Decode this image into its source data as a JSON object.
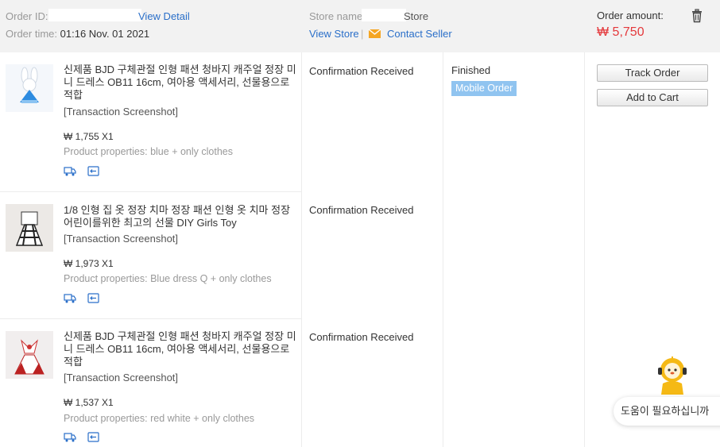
{
  "header": {
    "order_id_label": "Order ID:",
    "view_detail": "View Detail",
    "order_time_label": "Order time:",
    "order_time_value": "01:16 Nov. 01 2021",
    "store_name_label": "Store name:",
    "store_name_suffix": "Store",
    "view_store": "View Store",
    "separator": "|",
    "contact_seller": "Contact Seller",
    "amount_label": "Order amount:",
    "amount_value": "₩ 5,750"
  },
  "order": {
    "status_finished": "Finished",
    "badge": "Mobile Order",
    "track_order": "Track Order",
    "add_to_cart": "Add to Cart"
  },
  "items": [
    {
      "title": "신제품 BJD 구체관절 인형 패션 청바지 캐주얼 정장 미니 드레스 OB11 16cm, 여아용 액세서리, 선물용으로 적합",
      "snapshot": "[Transaction Screenshot]",
      "price": "₩ 1,755 X1",
      "props": "Product properties: blue + only clothes",
      "status": "Confirmation Received"
    },
    {
      "title": "1/8 인형 집 옷 정장 치마 정장 패션 인형 옷 치마 정장 어린이를위한 최고의 선물 DIY Girls Toy",
      "snapshot": "[Transaction Screenshot]",
      "price": "₩ 1,973 X1",
      "props": "Product properties: Blue dress Q + only clothes",
      "status": "Confirmation Received"
    },
    {
      "title": "신제품 BJD 구체관절 인형 패션 청바지 캐주얼 정장 미니 드레스 OB11 16cm, 여아용 액세서리, 선물용으로 적합",
      "snapshot": "[Transaction Screenshot]",
      "price": "₩ 1,537 X1",
      "props": "Product properties: red white + only clothes",
      "status": "Confirmation Received"
    }
  ],
  "helper": {
    "bubble_text": "도움이 필요하십니까"
  },
  "colors": {
    "header_bg": "#f2f2f2",
    "link": "#2a6fc9",
    "amount": "#e4393c",
    "badge_bg": "#90c4f0"
  }
}
